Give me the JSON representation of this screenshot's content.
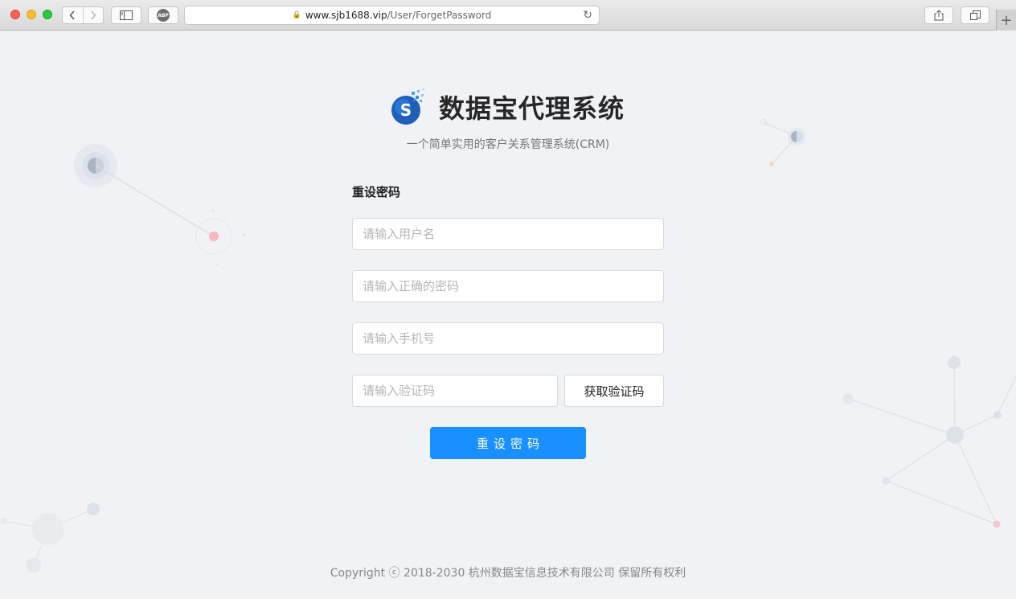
{
  "browser": {
    "url_host": "www.sjb1688.vip",
    "url_path": "/User/ForgetPassword",
    "abp_label": "ABP"
  },
  "brand": {
    "title": "数据宝代理系统",
    "subtitle": "一个简单实用的客户关系管理系统(CRM)",
    "logo_letter": "S"
  },
  "form": {
    "title": "重设密码",
    "username_placeholder": "请输入用户名",
    "password_placeholder": "请输入正确的密码",
    "phone_placeholder": "请输入手机号",
    "code_placeholder": "请输入验证码",
    "get_code_label": "获取验证码",
    "submit_label": "重设密码"
  },
  "footer": {
    "copyright": "Copyright ⓒ 2018-2030 杭州数据宝信息技术有限公司 保留所有权利"
  },
  "colors": {
    "primary": "#1890ff",
    "background": "#f0f2f5"
  }
}
